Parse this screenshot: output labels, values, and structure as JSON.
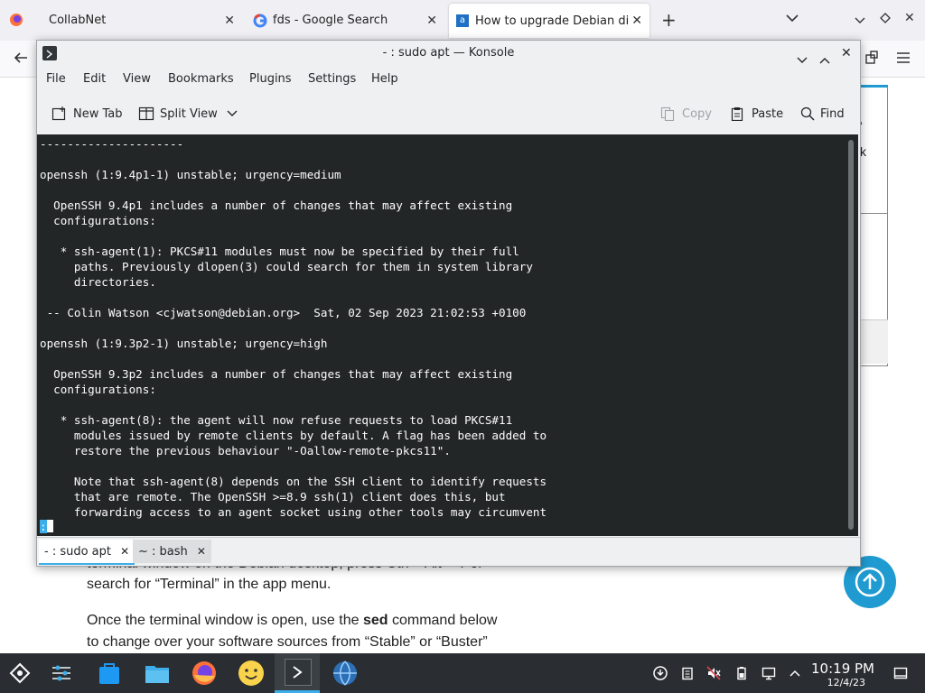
{
  "browser": {
    "tabs": [
      {
        "title": "CollabNet",
        "icon": "firefox-icon"
      },
      {
        "title": "fds - Google Search",
        "icon": "google-icon"
      },
      {
        "title": "How to upgrade Debian di",
        "icon": "site-icon"
      }
    ],
    "new_tab_symbol": "+"
  },
  "webpage": {
    "line1": "terminal window on the Debian desktop, press Ctrl + Alt + T or",
    "line2": "search for “Terminal” in the app menu.",
    "para2_pre": "Once the terminal window is open, use the ",
    "para2_bold": "sed",
    "para2_post": " command below",
    "para2_line2": "to change over your software sources from “Stable” or “Buster”",
    "side_char1": "‘",
    "side_char2": "k"
  },
  "konsole": {
    "title": "- : sudo apt — Konsole",
    "menu": [
      "File",
      "Edit",
      "View",
      "Bookmarks",
      "Plugins",
      "Settings",
      "Help"
    ],
    "toolbar": {
      "new_tab": "New Tab",
      "split_view": "Split View",
      "copy": "Copy",
      "paste": "Paste",
      "find": "Find"
    },
    "terminal_text": "---------------------\n\nopenssh (1:9.4p1-1) unstable; urgency=medium\n\n  OpenSSH 9.4p1 includes a number of changes that may affect existing\n  configurations:\n\n   * ssh-agent(1): PKCS#11 modules must now be specified by their full\n     paths. Previously dlopen(3) could search for them in system library\n     directories.\n\n -- Colin Watson <cjwatson@debian.org>  Sat, 02 Sep 2023 21:02:53 +0100\n\nopenssh (1:9.3p2-1) unstable; urgency=high\n\n  OpenSSH 9.3p2 includes a number of changes that may affect existing\n  configurations:\n\n   * ssh-agent(8): the agent will now refuse requests to load PKCS#11\n     modules issued by remote clients by default. A flag has been added to\n     restore the previous behaviour \"-Oallow-remote-pkcs11\".\n\n     Note that ssh-agent(8) depends on the SSH client to identify requests\n     that are remote. The OpenSSH >=8.9 ssh(1) client does this, but\n     forwarding access to an agent socket using other tools may circumvent",
    "prompt": ":",
    "tabs": [
      {
        "label": "- : sudo apt",
        "active": true
      },
      {
        "label": "~ : bash",
        "active": false
      }
    ]
  },
  "taskbar": {
    "time": "10:19 PM",
    "date": "12/4/23"
  },
  "colors": {
    "terminal_bg": "#232627",
    "terminal_fg": "#fcfcfc",
    "taskbar_bg": "#2a2e32",
    "accent": "#3daee9",
    "scroll_up_button": "#1f9bd1"
  }
}
